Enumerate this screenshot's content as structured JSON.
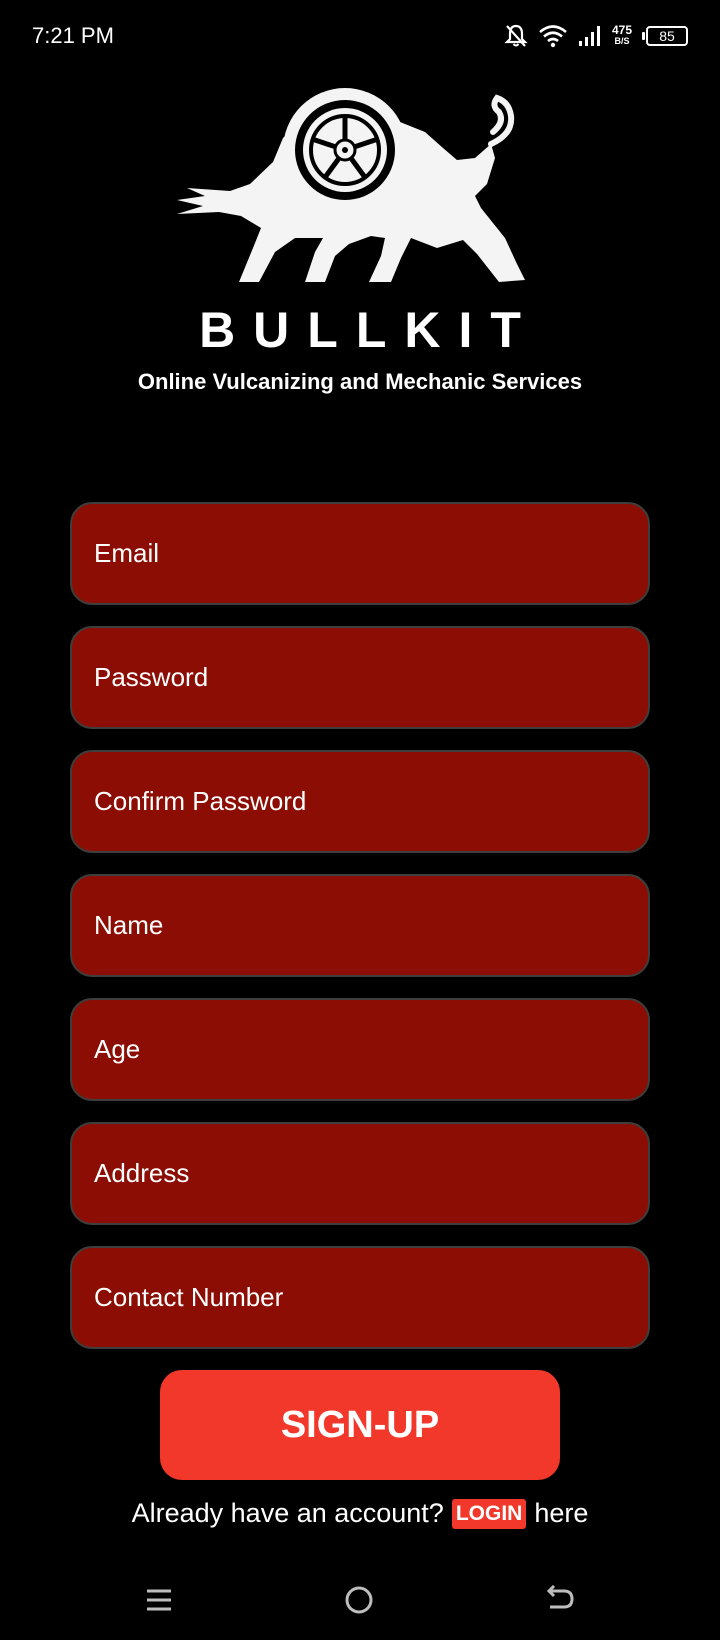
{
  "status_bar": {
    "time": "7:21 PM",
    "net_speed_value": "475",
    "net_speed_unit": "B/S",
    "battery_level": "85",
    "icons": [
      "mute-icon",
      "wifi-icon",
      "signal-icon",
      "battery-icon"
    ]
  },
  "branding": {
    "name": "BULLKIT",
    "tagline": "Online Vulcanizing and Mechanic Services",
    "logo_icon": "bull-wheel-logo"
  },
  "form": {
    "email_placeholder": "Email",
    "password_placeholder": "Password",
    "confirm_password_placeholder": "Confirm Password",
    "name_placeholder": "Name",
    "age_placeholder": "Age",
    "address_placeholder": "Address",
    "contact_placeholder": "Contact Number"
  },
  "signup_button_label": "SIGN-UP",
  "login_prompt": {
    "before": "Already have an account?",
    "link": "LOGIN",
    "after": "here"
  },
  "nav_bar": {
    "icons": [
      "menu-icon",
      "home-icon",
      "back-icon"
    ]
  },
  "colors": {
    "background": "#000000",
    "field_fill": "#8b0d04",
    "accent": "#f2382b",
    "text": "#ffffff"
  }
}
